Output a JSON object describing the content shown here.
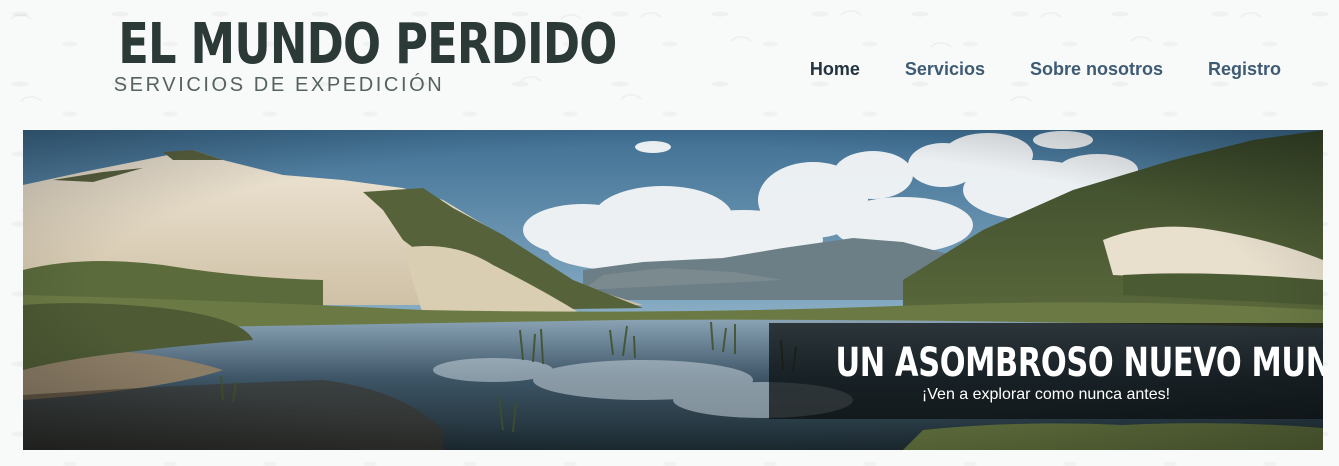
{
  "header": {
    "logo_title": "EL MUNDO PERDIDO",
    "logo_subtitle": "SERVICIOS DE EXPEDICIÓN"
  },
  "nav": {
    "items": [
      {
        "label": "Home",
        "active": true
      },
      {
        "label": "Servicios",
        "active": false
      },
      {
        "label": "Sobre nosotros",
        "active": false
      },
      {
        "label": "Registro",
        "active": false
      }
    ]
  },
  "hero": {
    "caption_title": "UN ASOMBROSO NUEVO MUNDO",
    "caption_subtitle": "¡Ven a explorar como nunca antes!"
  },
  "colors": {
    "logo_text": "#2b3a37",
    "nav_link": "#3e5b74",
    "nav_active": "#23333f",
    "caption_bg": "#0a0c0c"
  }
}
